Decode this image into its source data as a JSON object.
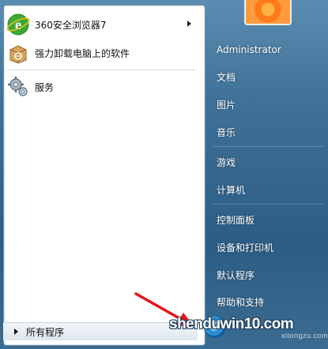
{
  "pinned_programs": [
    {
      "label": "360安全浏览器7",
      "icon": "browser-e-icon",
      "has_submenu": true
    },
    {
      "label": "强力卸载电脑上的软件",
      "icon": "uninstall-box-icon",
      "has_submenu": false
    }
  ],
  "recent_programs": [
    {
      "label": "服务",
      "icon": "gears-icon"
    }
  ],
  "all_programs": {
    "label": "所有程序"
  },
  "right_pane": {
    "user": "Administrator",
    "items": [
      "文档",
      "图片",
      "音乐",
      "游戏",
      "计算机",
      "控制面板",
      "设备和打印机",
      "默认程序",
      "帮助和支持"
    ]
  },
  "watermark": {
    "text": "shenduwin10.com",
    "sub": "xitongzu.com"
  },
  "colors": {
    "accent_arrow": "#e8141b",
    "menu_blue": "#2c5d85",
    "browser_green": "#3aa935"
  }
}
